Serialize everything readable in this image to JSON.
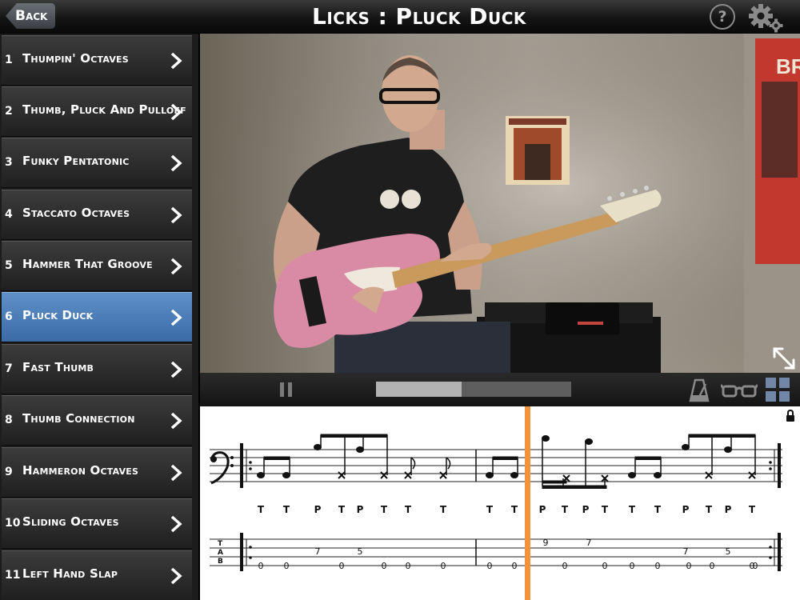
{
  "header": {
    "back_label": "Back",
    "title": "Licks : Pluck Duck",
    "help_label": "?"
  },
  "sidebar": {
    "active_index": 5,
    "items": [
      {
        "num": "1",
        "label": "Thumpin' Octaves"
      },
      {
        "num": "2",
        "label": "Thumb, Pluck And Pulloff"
      },
      {
        "num": "3",
        "label": "Funky Pentatonic"
      },
      {
        "num": "4",
        "label": "Staccato Octaves"
      },
      {
        "num": "5",
        "label": "Hammer That Groove"
      },
      {
        "num": "6",
        "label": "Pluck Duck"
      },
      {
        "num": "7",
        "label": "Fast Thumb"
      },
      {
        "num": "8",
        "label": "Thumb Connection"
      },
      {
        "num": "9",
        "label": "Hammeron Octaves"
      },
      {
        "num": "10",
        "label": "Sliding Octaves"
      },
      {
        "num": "11",
        "label": "Left Hand Slap"
      }
    ]
  },
  "video": {
    "poster_lettering": "BR",
    "progress": 0.44
  },
  "notation": {
    "technique_row": [
      "T",
      "T",
      "P",
      "T",
      "P",
      "T",
      "T",
      "T",
      "T",
      "T",
      "P",
      "T",
      "P",
      "T",
      "T",
      "T",
      "P",
      "T",
      "P",
      "T"
    ],
    "tab_numbers": [
      "0",
      "0",
      "7",
      "0",
      "5",
      "0",
      "0",
      "0",
      "0",
      "0",
      "9",
      "0",
      "7",
      "0",
      "0",
      "0",
      "0",
      "7",
      "0",
      "5",
      "0",
      "0"
    ],
    "tab_labels": [
      "T",
      "A",
      "B"
    ]
  },
  "colors": {
    "active_item": "#4a7cb8",
    "playhead": "#f5923e",
    "progress_fill": "#b3b3b3"
  },
  "icons": [
    "back-chevron-icon",
    "help-icon",
    "gear-icon",
    "chevron-right-icon",
    "expand-icon",
    "pause-icon",
    "metronome-icon",
    "glasses-icon",
    "grid-view-icon",
    "lock-icon",
    "bass-clef-icon"
  ]
}
